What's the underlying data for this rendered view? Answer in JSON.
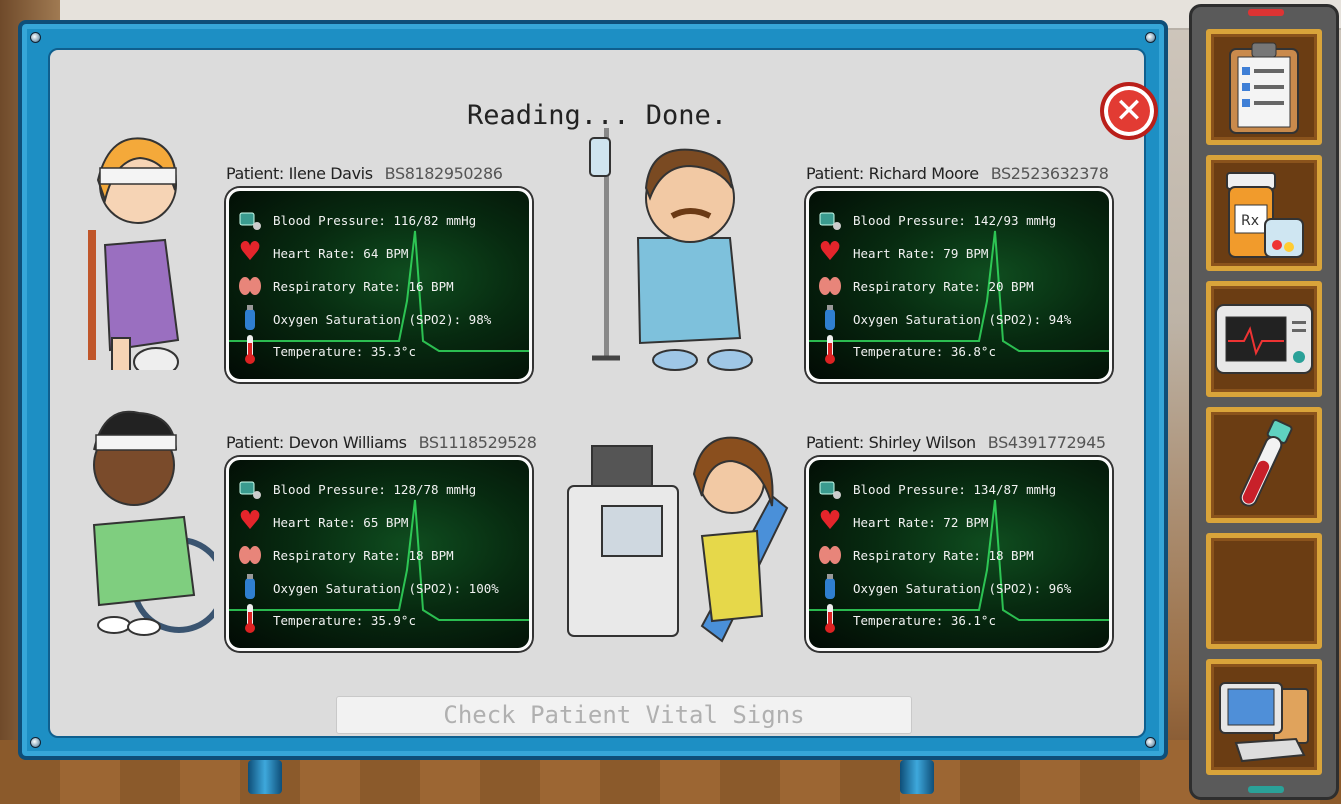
{
  "title": "Reading... Done.",
  "check_button": "Check Patient Vital Signs",
  "vital_labels": {
    "bp": "Blood Pressure:",
    "hr": "Heart Rate:",
    "rr": "Respiratory Rate:",
    "o2": "Oxygen Saturation (SPO2):",
    "temp": "Temperature:"
  },
  "patients": [
    {
      "label": "Patient: Ilene Davis",
      "id": "BS8182950286",
      "bp": "Blood Pressure: 116/82 mmHg",
      "hr": "Heart Rate: 64 BPM",
      "rr": "Respiratory Rate: 16 BPM",
      "o2": "Oxygen Saturation (SPO2): 98%",
      "temp": "Temperature: 35.3°c"
    },
    {
      "label": "Patient: Richard Moore",
      "id": "BS2523632378",
      "bp": "Blood Pressure: 142/93 mmHg",
      "hr": "Heart Rate: 79 BPM",
      "rr": "Respiratory Rate: 20 BPM",
      "o2": "Oxygen Saturation (SPO2): 94%",
      "temp": "Temperature: 36.8°c"
    },
    {
      "label": "Patient: Devon Williams",
      "id": "BS1118529528",
      "bp": "Blood Pressure: 128/78 mmHg",
      "hr": "Heart Rate: 65 BPM",
      "rr": "Respiratory Rate: 18 BPM",
      "o2": "Oxygen Saturation (SPO2): 100%",
      "temp": "Temperature: 35.9°c"
    },
    {
      "label": "Patient: Shirley Wilson",
      "id": "BS4391772945",
      "bp": "Blood Pressure: 134/87 mmHg",
      "hr": "Heart Rate: 72 BPM",
      "rr": "Respiratory Rate: 18 BPM",
      "o2": "Oxygen Saturation (SPO2): 96%",
      "temp": "Temperature: 36.1°c"
    }
  ],
  "sidebar": [
    "clipboard-icon",
    "medicine-icon",
    "monitor-icon",
    "blood-tube-icon",
    "empty-slot",
    "computer-icon"
  ],
  "colors": {
    "board": "#1d8fc4",
    "close": "#e23b33",
    "slot_border": "#d9a43a",
    "monitor_glow": "#3cff6e"
  }
}
